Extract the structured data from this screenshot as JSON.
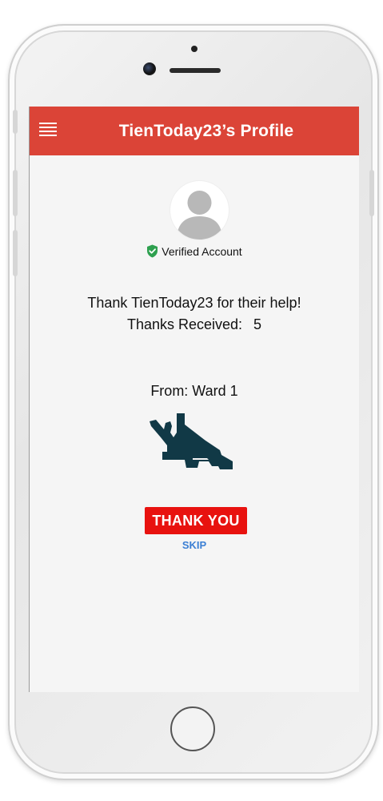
{
  "header": {
    "title": "TienToday23’s Profile",
    "menu_icon": "hamburger-menu-icon",
    "background_color": "#db4437"
  },
  "profile": {
    "avatar_icon": "user-silhouette-icon",
    "verified_label": "Verified Account",
    "verified_icon": "shield-check-icon",
    "verified_color": "#2ea04f"
  },
  "thanks": {
    "prompt": "Thank TienToday23 for their help!",
    "received_label": "Thanks Received:",
    "received_count": "5"
  },
  "from": {
    "label": "From: Ward 1",
    "map_icon": "ward-map-shape",
    "map_color": "#113946"
  },
  "actions": {
    "thank_you_label": "THANK YOU",
    "thank_you_color": "#e8120f",
    "skip_label": "SKIP",
    "skip_color": "#3b7fd4"
  }
}
